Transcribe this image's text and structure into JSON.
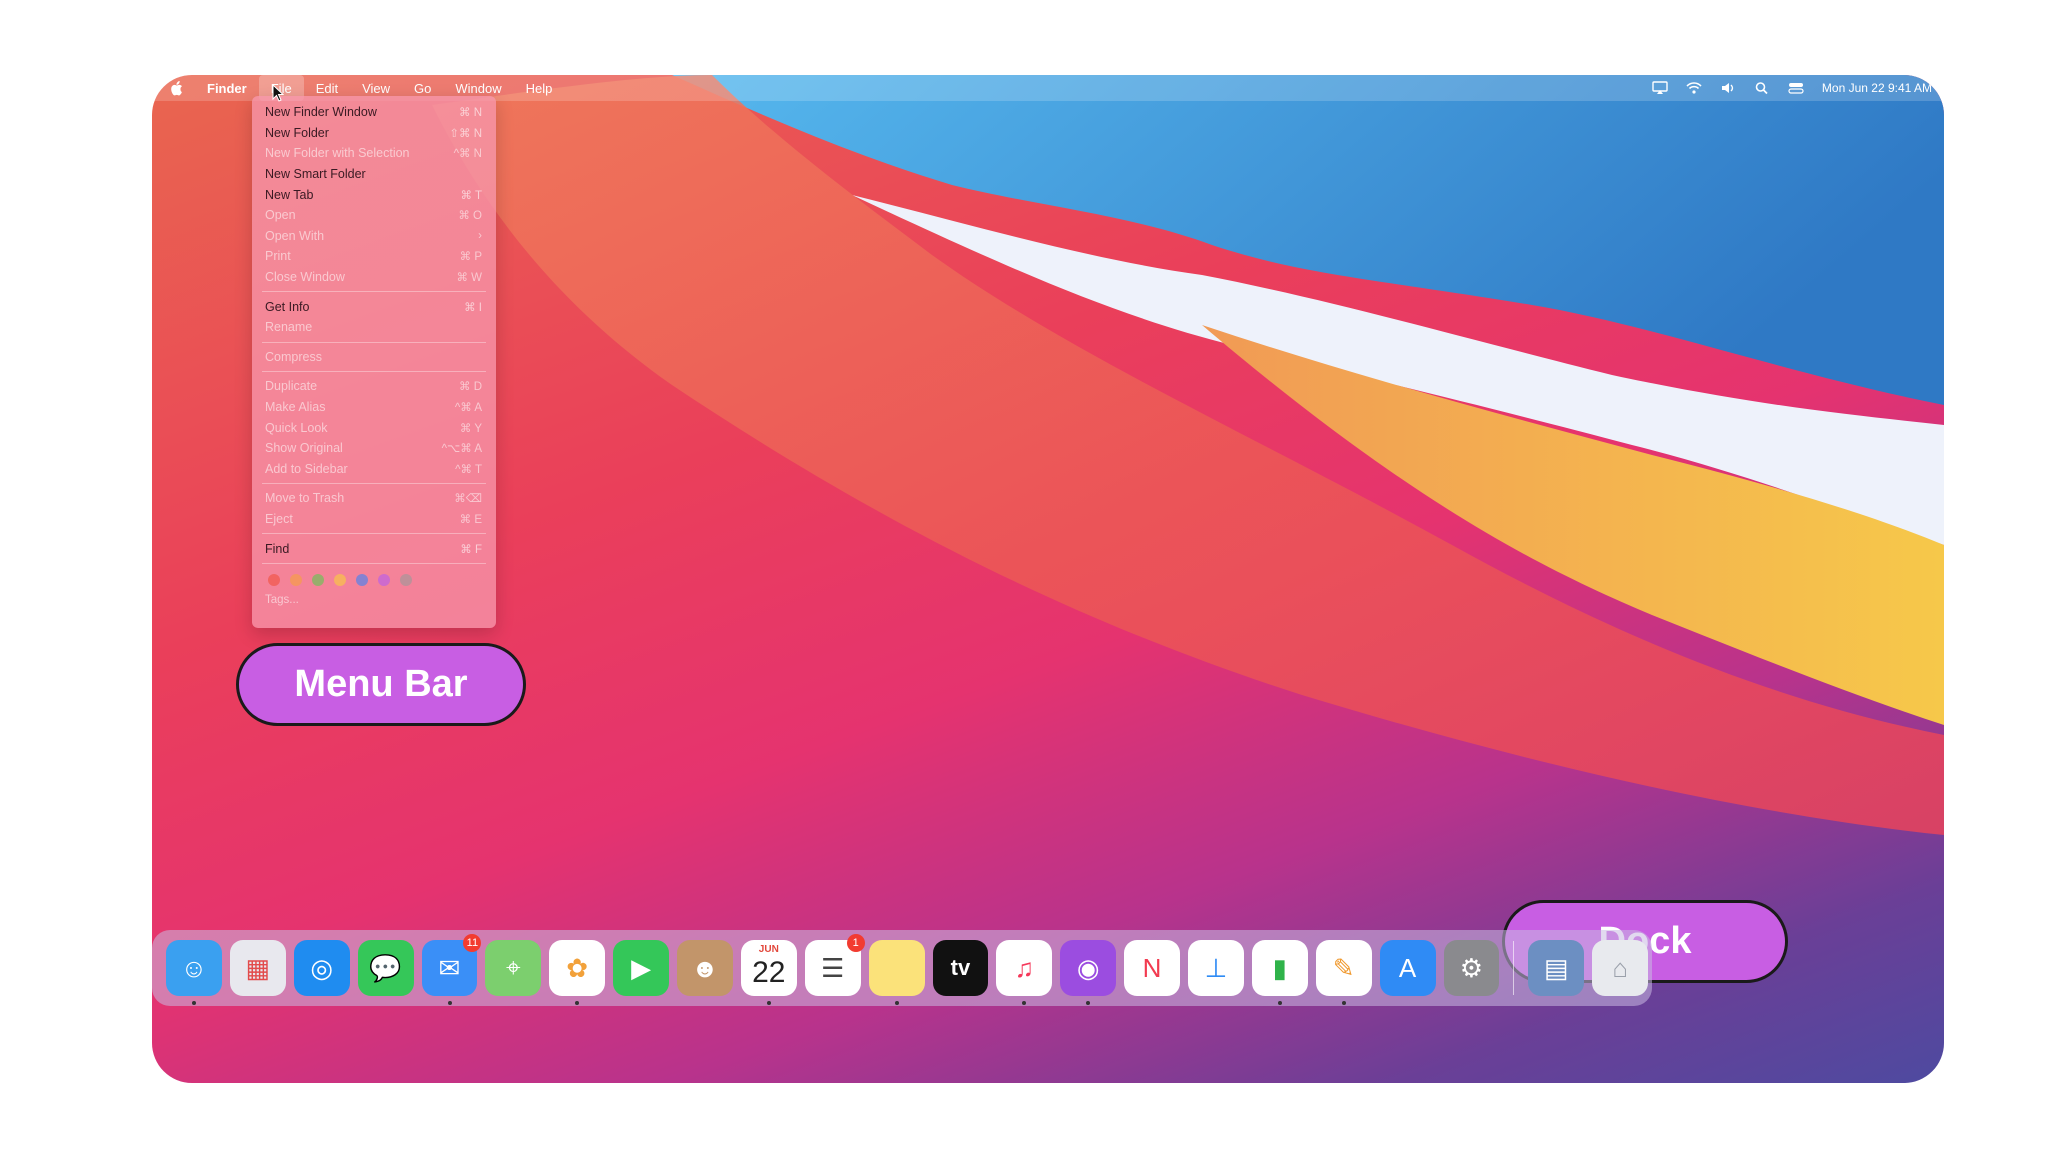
{
  "menubar": {
    "app_name": "Finder",
    "menus": [
      "File",
      "Edit",
      "View",
      "Go",
      "Window",
      "Help"
    ],
    "clock": "Mon Jun 22  9:41 AM"
  },
  "file_menu": {
    "items": [
      {
        "label": "New Finder Window",
        "shortcut": "⌘ N",
        "enabled": true
      },
      {
        "label": "New Folder",
        "shortcut": "⇧⌘ N",
        "enabled": true
      },
      {
        "label": "New Folder with Selection",
        "shortcut": "^⌘ N",
        "enabled": false
      },
      {
        "label": "New Smart Folder",
        "shortcut": "",
        "enabled": true
      },
      {
        "label": "New Tab",
        "shortcut": "⌘ T",
        "enabled": true
      },
      {
        "label": "Open",
        "shortcut": "⌘ O",
        "enabled": false
      },
      {
        "label": "Open With",
        "shortcut": "›",
        "enabled": false
      },
      {
        "label": "Print",
        "shortcut": "⌘ P",
        "enabled": false
      },
      {
        "label": "Close Window",
        "shortcut": "⌘ W",
        "enabled": false
      },
      {
        "label": "Get Info",
        "shortcut": "⌘ I",
        "enabled": true
      },
      {
        "label": "Rename",
        "shortcut": "",
        "enabled": false
      },
      {
        "label": "Compress",
        "shortcut": "",
        "enabled": false
      },
      {
        "label": "Duplicate",
        "shortcut": "⌘ D",
        "enabled": false
      },
      {
        "label": "Make Alias",
        "shortcut": "^⌘ A",
        "enabled": false
      },
      {
        "label": "Quick Look",
        "shortcut": "⌘ Y",
        "enabled": false
      },
      {
        "label": "Show Original",
        "shortcut": "^⌥⌘ A",
        "enabled": false
      },
      {
        "label": "Add to Sidebar",
        "shortcut": "^⌘ T",
        "enabled": false
      },
      {
        "label": "Move to Trash",
        "shortcut": "⌘⌫",
        "enabled": false
      },
      {
        "label": "Eject",
        "shortcut": "⌘ E",
        "enabled": false
      },
      {
        "label": "Find",
        "shortcut": "⌘ F",
        "enabled": true
      }
    ],
    "tag_colors": [
      "#f0503c",
      "#f5a23c",
      "#5cc94f",
      "#f8cf3a",
      "#3b82f6",
      "#b45cf0",
      "#9a9a9a"
    ],
    "tags_label": "Tags..."
  },
  "callouts": {
    "menu_bar": "Menu Bar",
    "dock": "Dock"
  },
  "dock": {
    "apps": [
      {
        "name": "Finder",
        "icon": "finder-icon",
        "color": "#3aa0f0",
        "running": true
      },
      {
        "name": "Launchpad",
        "icon": "launchpad-icon",
        "color": "#e8e8ee",
        "running": false
      },
      {
        "name": "Safari",
        "icon": "safari-icon",
        "color": "#1f8cf0",
        "running": false
      },
      {
        "name": "Messages",
        "icon": "messages-icon",
        "color": "#35c759",
        "running": false
      },
      {
        "name": "Mail",
        "icon": "mail-icon",
        "color": "#3a8ff7",
        "running": true,
        "badge": "11"
      },
      {
        "name": "Maps",
        "icon": "maps-icon",
        "color": "#7ccf6e",
        "running": false
      },
      {
        "name": "Photos",
        "icon": "photos-icon",
        "color": "#ffffff",
        "running": true
      },
      {
        "name": "FaceTime",
        "icon": "facetime-icon",
        "color": "#34c759",
        "running": false
      },
      {
        "name": "Contacts",
        "icon": "contacts-icon",
        "color": "#c2956a",
        "running": false
      },
      {
        "name": "Calendar",
        "icon": "calendar-icon",
        "color": "#ffffff",
        "running": true,
        "month": "JUN",
        "day": "22"
      },
      {
        "name": "Reminders",
        "icon": "reminders-icon",
        "color": "#ffffff",
        "running": false,
        "badge": "1"
      },
      {
        "name": "Notes",
        "icon": "notes-icon",
        "color": "#fbe27a",
        "running": true
      },
      {
        "name": "TV",
        "icon": "tv-icon",
        "color": "#111111",
        "running": false,
        "text": "tv"
      },
      {
        "name": "Music",
        "icon": "music-icon",
        "color": "#ffffff",
        "running": true
      },
      {
        "name": "Podcasts",
        "icon": "podcasts-icon",
        "color": "#9b4de0",
        "running": true
      },
      {
        "name": "News",
        "icon": "news-icon",
        "color": "#ffffff",
        "running": false
      },
      {
        "name": "Keynote",
        "icon": "keynote-icon",
        "color": "#ffffff",
        "running": false
      },
      {
        "name": "Numbers",
        "icon": "numbers-icon",
        "color": "#ffffff",
        "running": true
      },
      {
        "name": "Pages",
        "icon": "pages-icon",
        "color": "#ffffff",
        "running": true
      },
      {
        "name": "App Store",
        "icon": "appstore-icon",
        "color": "#2f8bf5",
        "running": false
      },
      {
        "name": "System Preferences",
        "icon": "settings-icon",
        "color": "#8a8a8e",
        "running": false
      }
    ],
    "right_items": [
      {
        "name": "Downloads stack",
        "icon": "stack-icon",
        "color": "#6c8fc2"
      },
      {
        "name": "Trash",
        "icon": "trash-icon",
        "color": "#e8eaee"
      }
    ]
  }
}
